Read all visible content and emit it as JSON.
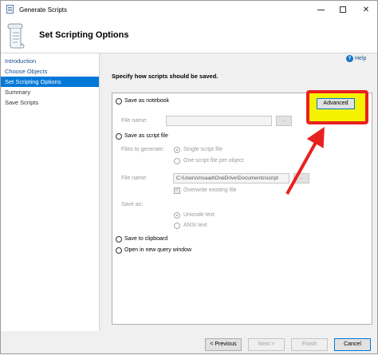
{
  "window": {
    "title": "Generate Scripts"
  },
  "header": {
    "title": "Set Scripting Options"
  },
  "sidebar": {
    "items": [
      {
        "label": "Introduction"
      },
      {
        "label": "Choose Objects"
      },
      {
        "label": "Set Scripting Options"
      },
      {
        "label": "Summary"
      },
      {
        "label": "Save Scripts"
      }
    ]
  },
  "help": {
    "label": "Help"
  },
  "main": {
    "instruction": "Specify how scripts should be saved.",
    "notebook": {
      "option": "Save as notebook",
      "file_name_label": "File name:",
      "advanced": "Advanced"
    },
    "script_file": {
      "option": "Save as script file",
      "files_label": "Files to generate:",
      "single": "Single script file",
      "per_object": "One script file per object",
      "file_name_label": "File name:",
      "file_name_value": "C:\\Users\\msaad\\OneDrive\\Documents\\script",
      "overwrite": "Overwrite existing file",
      "save_as_label": "Save as:",
      "unicode": "Unicode text",
      "ansi": "ANSI text"
    },
    "clipboard": "Save to clipboard",
    "query_window": "Open in new query window"
  },
  "footer": {
    "previous": "< Previous",
    "next": "Next >",
    "finish": "Finish",
    "cancel": "Cancel"
  },
  "colors": {
    "accent": "#0078d7",
    "highlight": "#f5f200",
    "annotation": "#e8211f"
  }
}
